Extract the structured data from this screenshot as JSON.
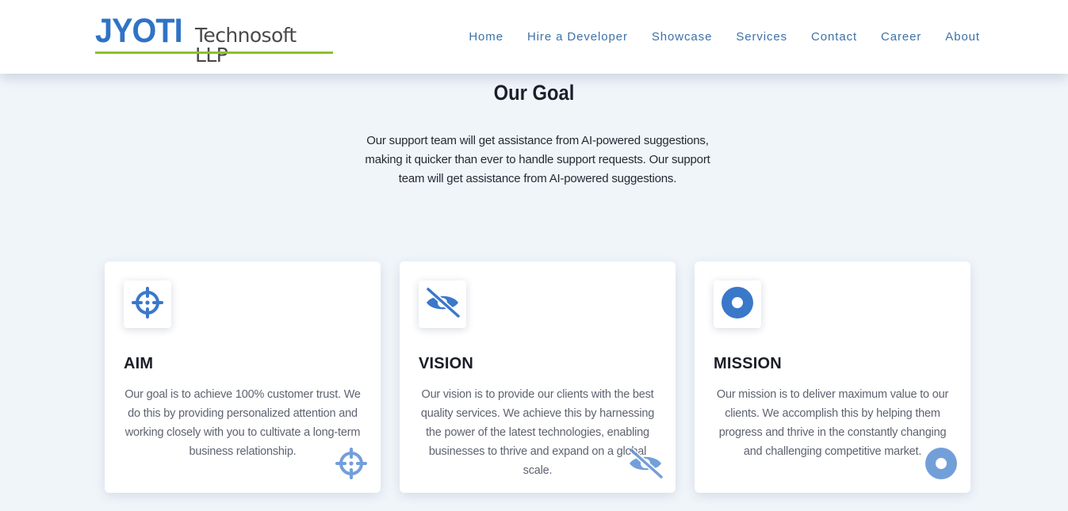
{
  "brand": {
    "name_main": "JYOTI",
    "name_sub": "Technosoft LLP",
    "accent_color": "#2f73c6",
    "underline_color": "#8dc12e"
  },
  "nav": {
    "items": [
      "Home",
      "Hire a Developer",
      "Showcase",
      "Services",
      "Contact",
      "Career",
      "About"
    ],
    "color": "#3d72a8"
  },
  "goal": {
    "title": "Our Goal",
    "description": "Our support team will get assistance from AI-powered suggestions, making it quicker than ever to handle support requests. Our support team will get assistance from AI-powered suggestions."
  },
  "cards": [
    {
      "icon": "crosshairs-icon",
      "title": "AIM",
      "text": "Our goal is to achieve 100% customer trust. We do this by providing personalized attention and working closely with you to cultivate a long-term business relationship."
    },
    {
      "icon": "eye-slash-icon",
      "title": "VISION",
      "text": "Our vision is to provide our clients with the best quality services. We achieve this by harnessing the power of the latest technologies, enabling businesses to thrive and expand on a global scale."
    },
    {
      "icon": "dot-circle-icon",
      "title": "MISSION",
      "text": "Our mission is to deliver maximum value to our clients. We accomplish this by helping them progress and thrive in the constantly changing and challenging competitive market."
    }
  ],
  "colors": {
    "background": "#f0f5fa",
    "icon": "#3a78c9"
  }
}
